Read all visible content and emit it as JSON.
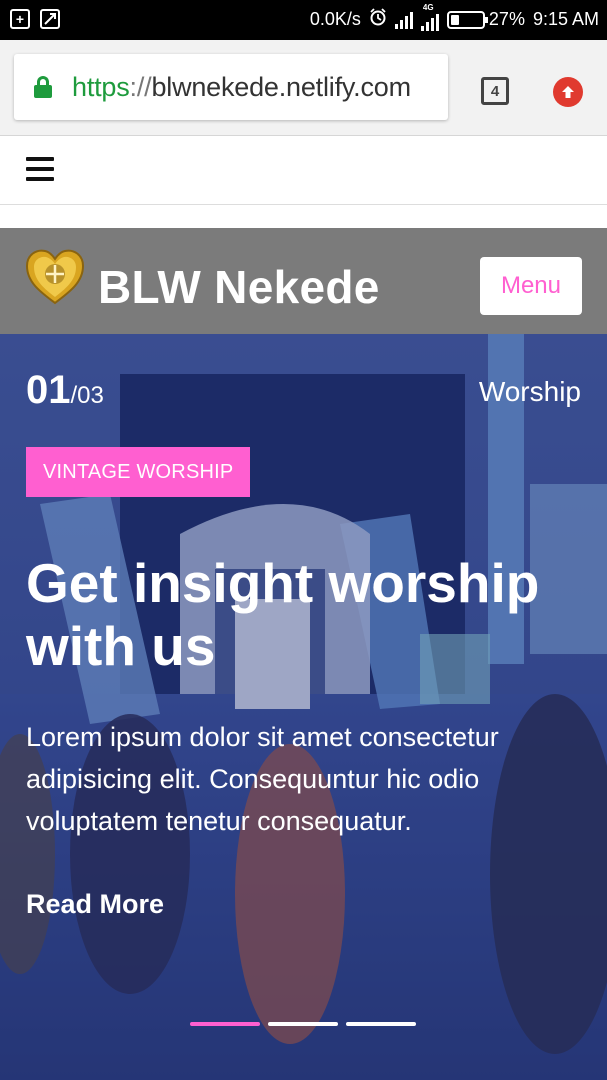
{
  "status_bar": {
    "speed": "0.0K/s",
    "network": "4G",
    "battery": "27%",
    "battery_level": 0.27,
    "time": "9:15 AM"
  },
  "browser": {
    "url_scheme": "https",
    "url_separator": "://",
    "url_host": "blwnekede.netlify.com",
    "tab_count": "4"
  },
  "site": {
    "title": "BLW Nekede",
    "menu_label": "Menu"
  },
  "hero": {
    "slide_current": "01",
    "slide_total": "/03",
    "category": "Worship",
    "badge": "VINTAGE WORSHIP",
    "title": "Get insight worship with us",
    "text": "Lorem ipsum dolor sit amet consectetur adipisicing elit. Consequuntur hic odio voluptatem tenetur consequatur.",
    "read_more": "Read More",
    "active_slide": 1
  },
  "colors": {
    "accent": "#ff5fd0",
    "header_bg": "#7b7b7b",
    "secure_green": "#1e9b3d",
    "update_red": "#e03a2f"
  },
  "icons": [
    "battery-saver-icon",
    "screenshot-icon",
    "alarm-icon",
    "signal-icon",
    "battery-icon",
    "lock-icon",
    "tabs-icon",
    "update-icon",
    "hamburger-menu-icon",
    "site-logo-icon"
  ]
}
